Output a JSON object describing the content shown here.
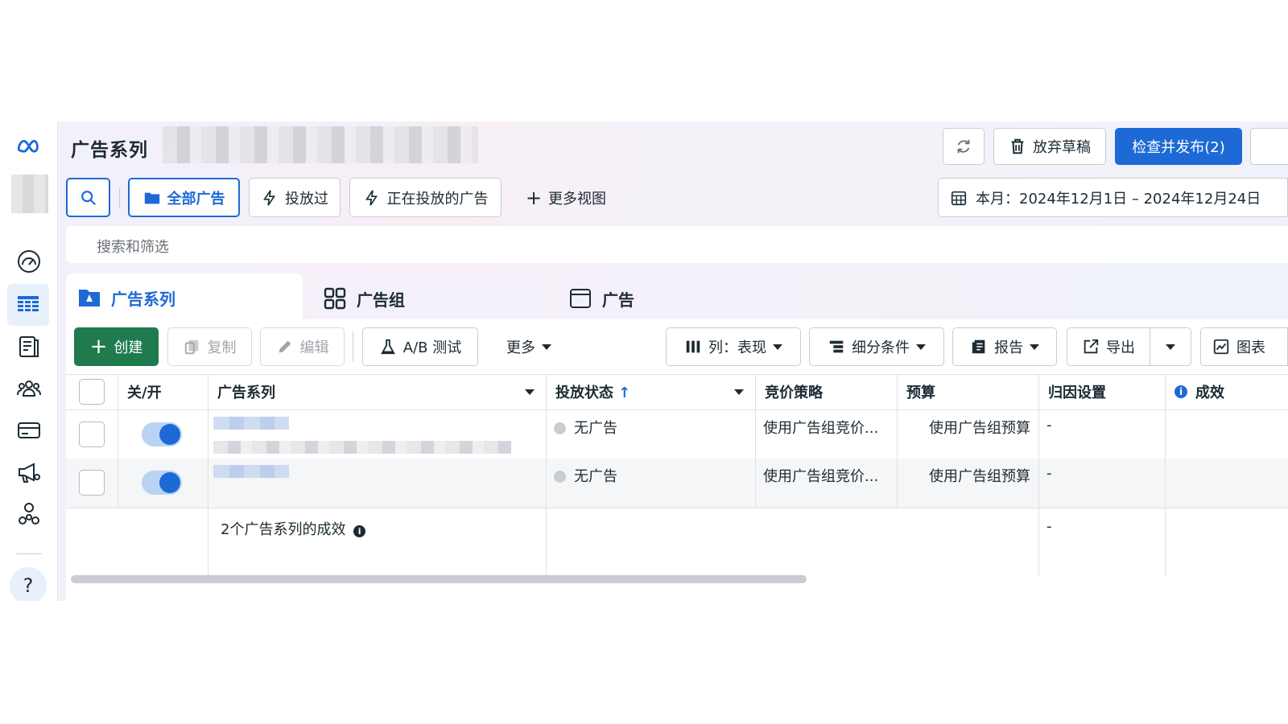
{
  "header": {
    "title": "广告系列",
    "refresh_icon": "refresh-icon",
    "discard_label": "放弃草稿",
    "publish_label": "检查并发布(2)",
    "date_range": "本月：2024年12月1日 – 2024年12月24日"
  },
  "views": {
    "all_ads": "全部广告",
    "delivered": "投放过",
    "active": "正在投放的广告",
    "more_views": "更多视图"
  },
  "search": {
    "placeholder": "搜索和筛选"
  },
  "tabs": [
    {
      "label": "广告系列"
    },
    {
      "label": "广告组"
    },
    {
      "label": "广告"
    }
  ],
  "toolbar": {
    "create": "创建",
    "copy": "复制",
    "edit": "编辑",
    "ab_test": "A/B 测试",
    "more": "更多",
    "columns": "列：表现",
    "breakdown": "细分条件",
    "reports": "报告",
    "export": "导出",
    "charts": "图表"
  },
  "table": {
    "headers": {
      "toggle": "关/开",
      "campaign": "广告系列",
      "delivery": "投放状态",
      "delivery_sort": "↑",
      "bid": "竞价策略",
      "budget": "预算",
      "attribution": "归因设置",
      "results": "成效"
    },
    "rows": [
      {
        "delivery": "无广告",
        "bid": "使用广告组竞价...",
        "budget": "使用广告组预算",
        "attribution": "-",
        "on": true
      },
      {
        "delivery": "无广告",
        "bid": "使用广告组竞价...",
        "budget": "使用广告组预算",
        "attribution": "-",
        "on": true
      }
    ],
    "summary": {
      "label": "2个广告系列的成效",
      "attribution": "-"
    }
  },
  "colors": {
    "accent": "#1d6ad6",
    "create": "#1f7a4e"
  }
}
